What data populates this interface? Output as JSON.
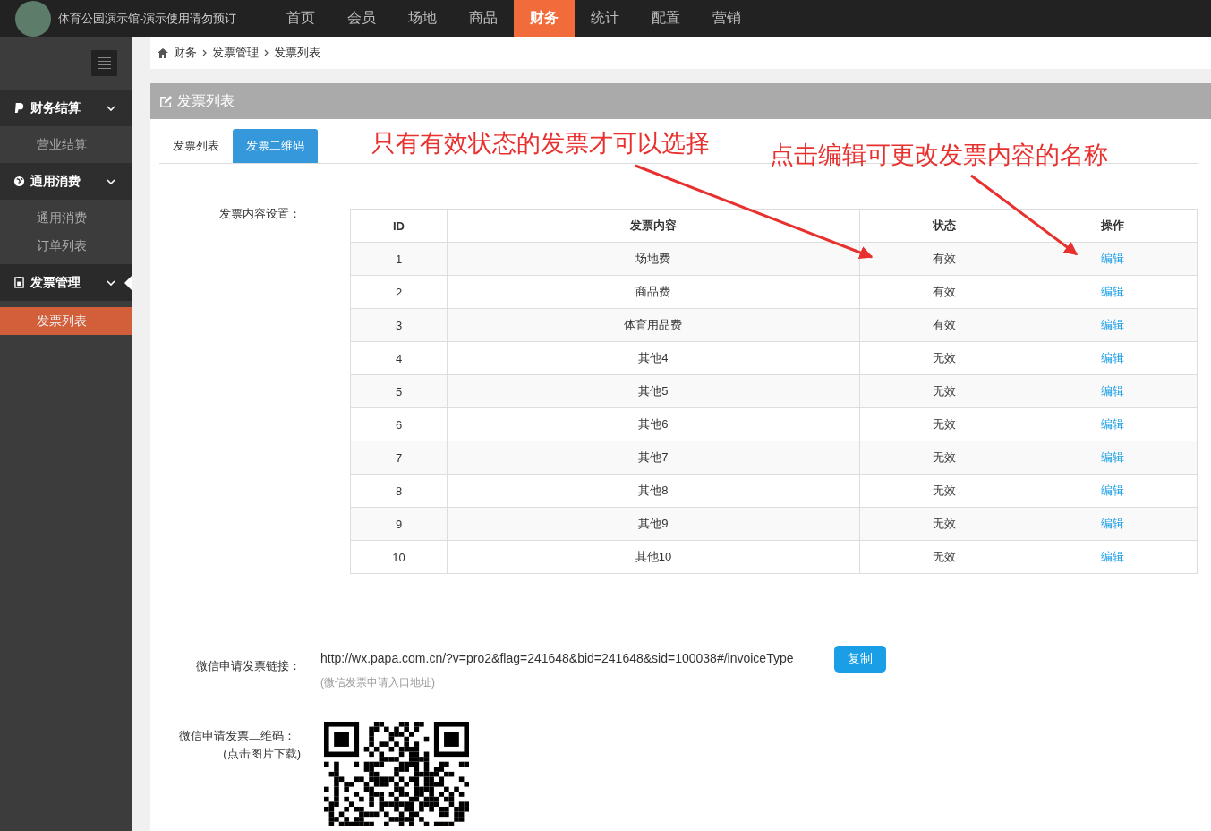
{
  "brand": {
    "title": "体育公园演示馆-演示使用请勿预订"
  },
  "nav": [
    {
      "label": "首页",
      "selected": false
    },
    {
      "label": "会员",
      "selected": false
    },
    {
      "label": "场地",
      "selected": false
    },
    {
      "label": "商品",
      "selected": false
    },
    {
      "label": "财务",
      "selected": true
    },
    {
      "label": "统计",
      "selected": false
    },
    {
      "label": "配置",
      "selected": false
    },
    {
      "label": "营销",
      "selected": false
    }
  ],
  "sidebar": {
    "groups": [
      {
        "label": "财务结算",
        "kind": "pay",
        "selected": false,
        "expanded": true,
        "items": [
          {
            "label": "营业结算",
            "selected": false
          }
        ]
      },
      {
        "label": "通用消费",
        "kind": "globe",
        "selected": false,
        "expanded": true,
        "items": [
          {
            "label": "通用消费",
            "selected": false
          },
          {
            "label": "订单列表",
            "selected": false
          }
        ]
      },
      {
        "label": "发票管理",
        "kind": "invoice",
        "selected": true,
        "expanded": true,
        "items": [
          {
            "label": "发票列表",
            "selected": true
          }
        ]
      }
    ]
  },
  "breadcrumb": [
    "财务",
    "发票管理",
    "发票列表"
  ],
  "panel": {
    "title": "发票列表",
    "tabs": [
      {
        "label": "发票列表",
        "selected": false
      },
      {
        "label": "发票二维码",
        "selected": true
      }
    ],
    "content_label": "发票内容设置：",
    "table": {
      "columns": [
        "ID",
        "发票内容",
        "状态",
        "操作"
      ],
      "rows": [
        [
          "1",
          "场地费",
          "有效",
          "编辑"
        ],
        [
          "2",
          "商品费",
          "有效",
          "编辑"
        ],
        [
          "3",
          "体育用品费",
          "有效",
          "编辑"
        ],
        [
          "4",
          "其他4",
          "无效",
          "编辑"
        ],
        [
          "5",
          "其他5",
          "无效",
          "编辑"
        ],
        [
          "6",
          "其他6",
          "无效",
          "编辑"
        ],
        [
          "7",
          "其他7",
          "无效",
          "编辑"
        ],
        [
          "8",
          "其他8",
          "无效",
          "编辑"
        ],
        [
          "9",
          "其他9",
          "无效",
          "编辑"
        ],
        [
          "10",
          "其他10",
          "无效",
          "编辑"
        ]
      ]
    },
    "link_label": "微信申请发票链接：",
    "link_url": "http://wx.papa.com.cn/?v=pro2&flag=241648&bid=241648&sid=100038#/invoiceType",
    "copy_button": "复制",
    "link_hint": "(微信发票申请入口地址)",
    "qr_label": "微信申请发票二维码：",
    "qr_hint": "(点击图片下载)"
  },
  "annotations": [
    {
      "text": "只有有效状态的发票才可以选择"
    },
    {
      "text": "点击编辑可更改发票内容的名称"
    }
  ]
}
